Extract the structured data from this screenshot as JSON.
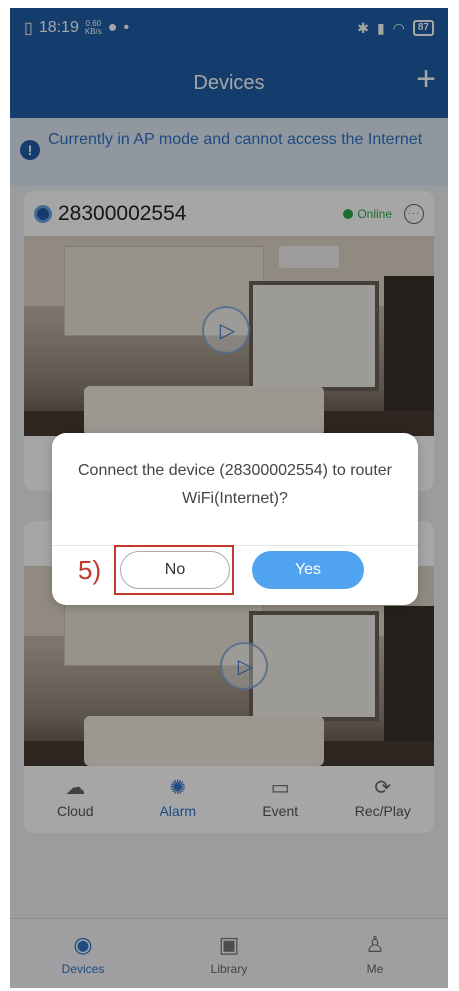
{
  "status_bar": {
    "time": "18:19",
    "net_speed_value": "0.60",
    "net_speed_unit": "KB/s",
    "battery": "87"
  },
  "header": {
    "title": "Devices",
    "add_label": "+"
  },
  "notice": {
    "icon": "!",
    "text": "Currently in AP mode and cannot access the Internet"
  },
  "devices": [
    {
      "id": "28300002554",
      "status": "Online"
    }
  ],
  "card_actions": [
    {
      "label": "Cloud",
      "icon": "cloud-upload-icon",
      "glyph": "☁"
    },
    {
      "label": "Alarm",
      "icon": "alarm-icon",
      "glyph": "✺"
    },
    {
      "label": "Event",
      "icon": "event-icon",
      "glyph": "▭"
    },
    {
      "label": "Rec/Play",
      "icon": "replay-icon",
      "glyph": "⟳"
    }
  ],
  "dialog": {
    "message": "Connect the device (28300002554) to router WiFi(Internet)?",
    "no_label": "No",
    "yes_label": "Yes",
    "step_annotation": "5)"
  },
  "tabbar": [
    {
      "label": "Devices",
      "icon": "camera-icon",
      "glyph": "◉",
      "active": true
    },
    {
      "label": "Library",
      "icon": "image-icon",
      "glyph": "▣",
      "active": false
    },
    {
      "label": "Me",
      "icon": "user-icon",
      "glyph": "♙",
      "active": false
    }
  ],
  "colors": {
    "primary": "#1f5da8",
    "accent": "#4fa3ef",
    "online": "#2aa84a",
    "annotation": "#c0392b"
  }
}
